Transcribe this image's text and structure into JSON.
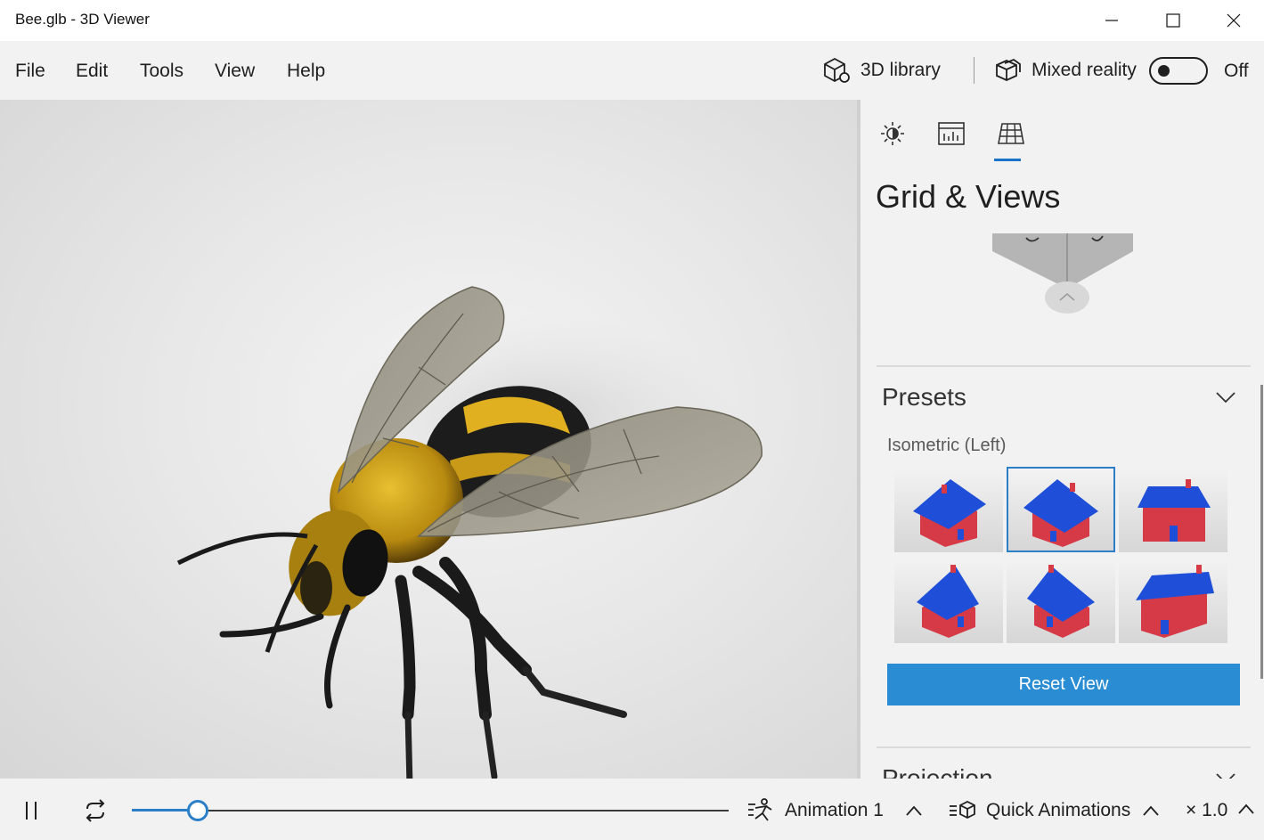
{
  "window": {
    "title": "Bee.glb - 3D Viewer"
  },
  "menu": {
    "items": [
      {
        "label": "File"
      },
      {
        "label": "Edit"
      },
      {
        "label": "Tools"
      },
      {
        "label": "View"
      },
      {
        "label": "Help"
      }
    ],
    "library_label": "3D library",
    "mixed_reality_label": "Mixed reality",
    "mixed_reality_state": "Off"
  },
  "panel": {
    "tabs": [
      {
        "name": "lighting",
        "icon": "sun-icon",
        "active": false
      },
      {
        "name": "stats",
        "icon": "stats-icon",
        "active": false
      },
      {
        "name": "grid",
        "icon": "grid-icon",
        "active": true
      }
    ],
    "title": "Grid & Views",
    "presets": {
      "title": "Presets",
      "selected_label": "Isometric (Left)",
      "selected_index": 1,
      "thumbnails": [
        "preset-1",
        "preset-2",
        "preset-3",
        "preset-4",
        "preset-5",
        "preset-6"
      ]
    },
    "reset_button": "Reset View",
    "projection_title": "Projection"
  },
  "playback": {
    "progress": 0.11,
    "animation_label": "Animation 1",
    "quick_animations_label": "Quick Animations",
    "speed_label": "× 1.0"
  },
  "colors": {
    "accent": "#2a7fc8",
    "button": "#2a8dd4",
    "house_roof": "#1f4fd8",
    "house_wall": "#d93440"
  }
}
